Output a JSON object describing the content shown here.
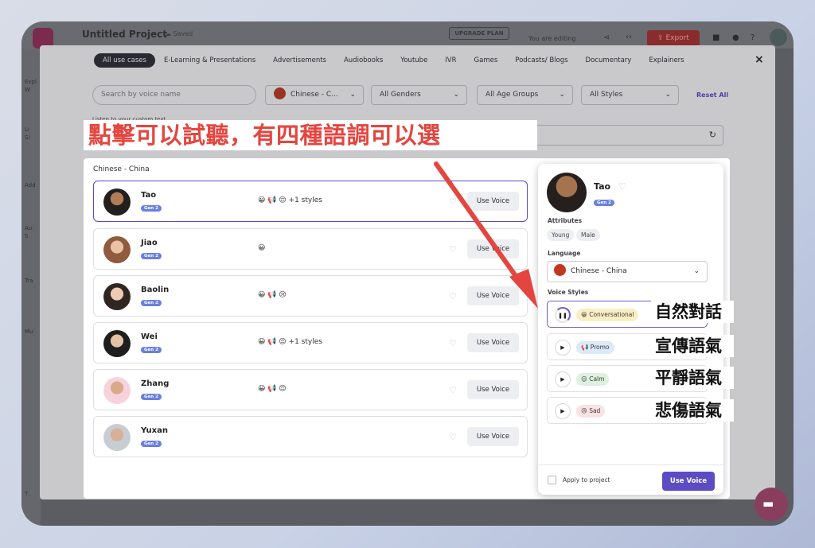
{
  "app": {
    "title": "Untitled Project",
    "saved": "☁ Saved",
    "upgrade": "UPGRADE PLAN",
    "editing": "You are editing",
    "export": "⇪ Export",
    "side_labels": [
      "Expl",
      "W",
      "Li",
      "Si",
      "Add",
      "Au",
      "S",
      "Tra",
      "Mu",
      "T"
    ]
  },
  "tabs": [
    "All use cases",
    "E-Learning & Presentations",
    "Advertisements",
    "Audiobooks",
    "Youtube",
    "IVR",
    "Games",
    "Podcasts/ Blogs",
    "Documentary",
    "Explainers"
  ],
  "close": "×",
  "filters": {
    "search_placeholder": "Search by voice name",
    "language": "Chinese - C...",
    "genders": "All Genders",
    "ages": "All Age Groups",
    "styles": "All Styles",
    "reset": "Reset All",
    "listen_label": "Listen to your custom text"
  },
  "region_label": "Chinese - China",
  "voices": [
    {
      "name": "Tao",
      "gen": "Gen 2",
      "styles": "😀 📢 😌 +1 styles",
      "use": "Use Voice"
    },
    {
      "name": "Jiao",
      "gen": "Gen 2",
      "styles": "😀",
      "use": "Use Voice"
    },
    {
      "name": "Baolin",
      "gen": "Gen 2",
      "styles": "😀 📢 😢",
      "use": "Use Voice"
    },
    {
      "name": "Wei",
      "gen": "Gen 2",
      "styles": "😀 📢 😌 +1 styles",
      "use": "Use Voice"
    },
    {
      "name": "Zhang",
      "gen": "Gen 2",
      "styles": "😀 📢 😌",
      "use": "Use Voice"
    },
    {
      "name": "Yuxan",
      "gen": "Gen 2",
      "styles": "",
      "use": "Use Voice"
    }
  ],
  "panel": {
    "name": "Tao",
    "gen": "Gen 2",
    "attributes_label": "Attributes",
    "attributes": [
      "Young",
      "Male"
    ],
    "language_label": "Language",
    "language": "Chinese - China",
    "voice_styles_label": "Voice Styles",
    "voice_styles": [
      {
        "label": "😀 Conversational",
        "color": "#fbeec3"
      },
      {
        "label": "📢 Promo",
        "color": "#dde9f8"
      },
      {
        "label": "😌 Calm",
        "color": "#dcf2df"
      },
      {
        "label": "😢 Sad",
        "color": "#fbe2e2"
      }
    ],
    "apply": "Apply to project",
    "use": "Use Voice"
  },
  "annotations": {
    "banner": "點擊可以試聽，有四種語調可以選",
    "labels": [
      "自然對話",
      "宣傳語氣",
      "平靜語氣",
      "悲傷語氣"
    ],
    "banner_color": "#e5453f"
  }
}
